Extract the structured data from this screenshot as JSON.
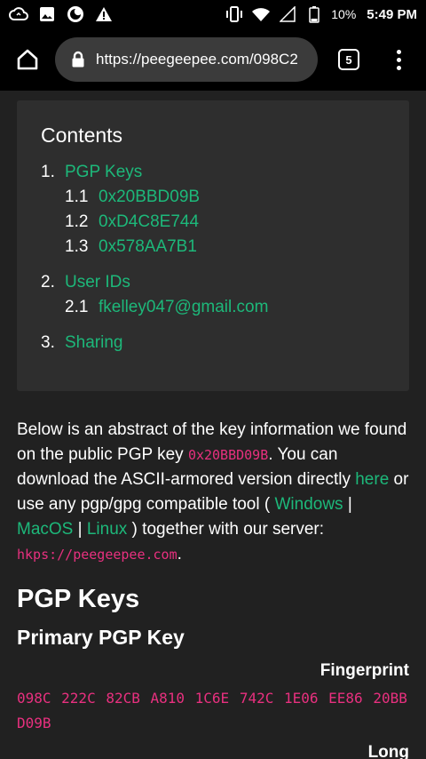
{
  "status_bar": {
    "battery": "10%",
    "time": "5:49 PM",
    "icons": [
      "cloud-sync-icon",
      "image-icon",
      "firefox-icon",
      "warning-icon",
      "vibrate-icon",
      "wifi-icon",
      "signal-icon",
      "battery-icon"
    ]
  },
  "browser": {
    "url": "https://peegeepee.com/098C2",
    "tab_count": "5"
  },
  "toc": {
    "title": "Contents",
    "items": [
      {
        "num": "1.",
        "label": "PGP Keys",
        "subs": [
          {
            "num": "1.1",
            "label": "0x20BBD09B"
          },
          {
            "num": "1.2",
            "label": "0xD4C8E744"
          },
          {
            "num": "1.3",
            "label": "0x578AA7B1"
          }
        ]
      },
      {
        "num": "2.",
        "label": "User IDs",
        "subs": [
          {
            "num": "2.1",
            "label": "fkelley047@gmail.com"
          }
        ]
      },
      {
        "num": "3.",
        "label": "Sharing",
        "subs": []
      }
    ]
  },
  "abstract": {
    "t1": "Below is an abstract of the key information we found on the public PGP key ",
    "key_code": "0x20BBD09B",
    "t2": ". You can download the ASCII-armored version directly ",
    "here_link": "here",
    "t3": " or use any pgp/gpg compatible tool ( ",
    "windows_link": "Windows",
    "sep1": " | ",
    "macos_link": "MacOS",
    "sep2": " | ",
    "linux_link": "Linux",
    "t4": " ) together with our server: ",
    "server_code": "hkps://peegeepee.com",
    "t5": "."
  },
  "pgp_keys": {
    "heading": "PGP Keys",
    "primary_heading": "Primary PGP Key",
    "fingerprint_label": "Fingerprint",
    "fingerprint_value": "098C 222C 82CB A810 1C6E 742C 1E06 EE86 20BB D09B",
    "long_label": "Long"
  },
  "colors": {
    "background": "#212121",
    "link": "#1db87a",
    "code": "#e8307f",
    "toc_panel": "#2e2e2e"
  }
}
